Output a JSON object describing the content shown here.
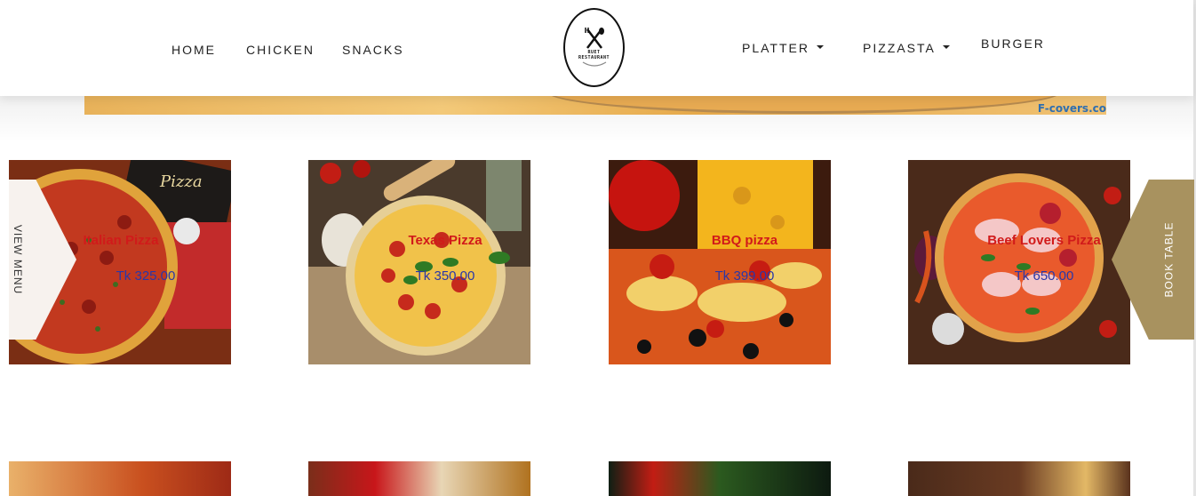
{
  "nav": {
    "left_items": [
      "HOME",
      "CHICKEN",
      "SNACKS"
    ],
    "right_items": [
      {
        "label": "PLATTER",
        "dropdown": true
      },
      {
        "label": "PIZZASTA",
        "dropdown": true
      },
      {
        "label": "BURGER",
        "dropdown": false
      }
    ]
  },
  "logo": {
    "line1": "RUET",
    "line2": "RESTAURANT"
  },
  "banner": {
    "watermark": "F-covers.co"
  },
  "side": {
    "left_label": "VIEW MENU",
    "right_label": "BOOK TABLE"
  },
  "menu": [
    {
      "name": "Italian Pizza",
      "price": "Tk 325.00"
    },
    {
      "name": "Texas Pizza",
      "price": "Tk 350.00"
    },
    {
      "name": "BBQ pizza",
      "price": "Tk 399.00"
    },
    {
      "name": "Beef Lovers Pizza",
      "price": "Tk 650.00"
    }
  ],
  "colors": {
    "title": "#d11a1a",
    "price": "#2a37a8",
    "book_tab": "#a8925f",
    "menu_tab": "#f7f2ee"
  }
}
